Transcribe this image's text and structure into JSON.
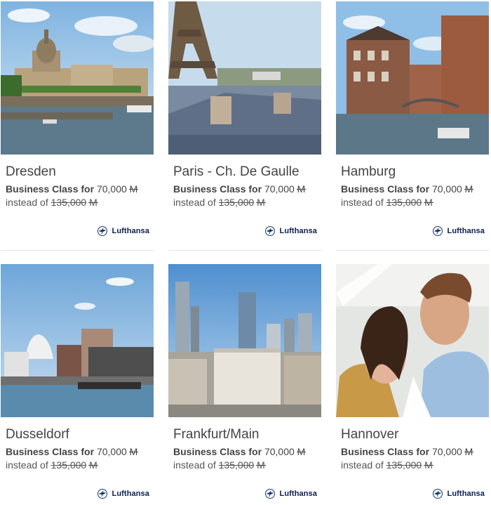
{
  "offers": [
    {
      "city": "Dresden",
      "class_label": "Business Class for",
      "price": "70,000",
      "miles_icon": "M",
      "instead_label": "instead of",
      "old_price": "135,000",
      "airline": "Lufthansa",
      "icon": "dresden-photo"
    },
    {
      "city": "Paris - Ch. De Gaulle",
      "class_label": "Business Class for",
      "price": "70,000",
      "miles_icon": "M",
      "instead_label": "instead of",
      "old_price": "135,000",
      "airline": "Lufthansa",
      "icon": "paris-photo"
    },
    {
      "city": "Hamburg",
      "class_label": "Business Class for",
      "price": "70,000",
      "miles_icon": "M",
      "instead_label": "instead of",
      "old_price": "135,000",
      "airline": "Lufthansa",
      "icon": "hamburg-photo"
    },
    {
      "city": "Dusseldorf",
      "class_label": "Business Class for",
      "price": "70,000",
      "miles_icon": "M",
      "instead_label": "instead of",
      "old_price": "135,000",
      "airline": "Lufthansa",
      "icon": "dusseldorf-photo"
    },
    {
      "city": "Frankfurt/Main",
      "class_label": "Business Class for",
      "price": "70,000",
      "miles_icon": "M",
      "instead_label": "instead of",
      "old_price": "135,000",
      "airline": "Lufthansa",
      "icon": "frankfurt-photo"
    },
    {
      "city": "Hannover",
      "class_label": "Business Class for",
      "price": "70,000",
      "miles_icon": "M",
      "instead_label": "instead of",
      "old_price": "135,000",
      "airline": "Lufthansa",
      "icon": "hannover-photo"
    }
  ],
  "colors": {
    "airline_navy": "#0a1d4d",
    "text": "#444444",
    "divider": "#e2e2e2"
  }
}
